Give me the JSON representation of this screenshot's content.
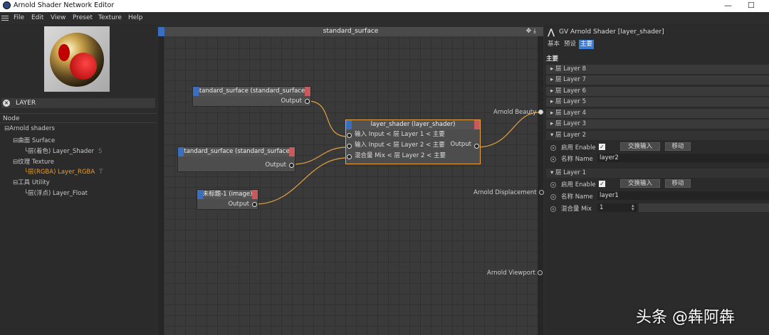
{
  "window": {
    "title": "Arnold Shader Network Editor",
    "minimize": "—",
    "maximize": "☐"
  },
  "menu": [
    "File",
    "Edit",
    "View",
    "Preset",
    "Texture",
    "Help"
  ],
  "left": {
    "search_value": "LAYER",
    "node_header": "Node",
    "tree": [
      {
        "label": "Arnold shaders",
        "tag": ""
      },
      {
        "label": "曲面 Surface",
        "tag": ""
      },
      {
        "label": "层(着色) Layer_Shader",
        "tag": "S"
      },
      {
        "label": "纹理 Texture",
        "tag": ""
      },
      {
        "label": "层(RGBA) Layer_RGBA",
        "tag": "T"
      },
      {
        "label": "工具 Utility",
        "tag": ""
      },
      {
        "label": "层(浮点) Layer_Float",
        "tag": ""
      }
    ]
  },
  "editor": {
    "title": "standard_surface",
    "controls": "✥ ⤓",
    "nodes": {
      "n1": {
        "title": "standard_surface (standard_surface)",
        "out": "Output"
      },
      "n2": {
        "title": "standard_surface (standard_surface)",
        "out": "Output"
      },
      "n3": {
        "title": "未标题-1 (image)",
        "out": "Output"
      },
      "layer": {
        "title": "layer_shader (layer_shader)",
        "in1": "输入 Input < 层 Layer 1 < 主要",
        "in2": "输入 Input < 层 Layer 2 < 主要",
        "in3": "混合量 Mix < 层 Layer 2 < 主要",
        "out": "Output"
      }
    },
    "endpoints": {
      "beauty": "Arnold Beauty",
      "displacement": "Arnold Displacement",
      "viewport": "Arnold Viewport"
    }
  },
  "right": {
    "title": "GV Arnold Shader [layer_shader]",
    "tabs": [
      "基本",
      "预设",
      "主要"
    ],
    "section": "主要",
    "layers_collapsed": [
      "▸ 层 Layer 8",
      "▸ 层 Layer 7",
      "▸ 层 Layer 6",
      "▸ 层 Layer 5",
      "▸ 层 Layer 4",
      "▸ 层 Layer 3"
    ],
    "layer2": {
      "header": "▾ 层 Layer 2",
      "enable_label": "启用 Enable",
      "swap_btn": "交换输入",
      "move_btn": "移动",
      "name_label": "名称 Name",
      "name_value": "layer2"
    },
    "layer1": {
      "header": "▾ 层 Layer 1",
      "enable_label": "启用 Enable",
      "swap_btn": "交换输入",
      "move_btn": "移动",
      "name_label": "名称 Name",
      "name_value": "layer1",
      "mix_label": "混合量 Mix",
      "mix_value": "1"
    }
  },
  "watermark": "头条 @犇阿犇"
}
